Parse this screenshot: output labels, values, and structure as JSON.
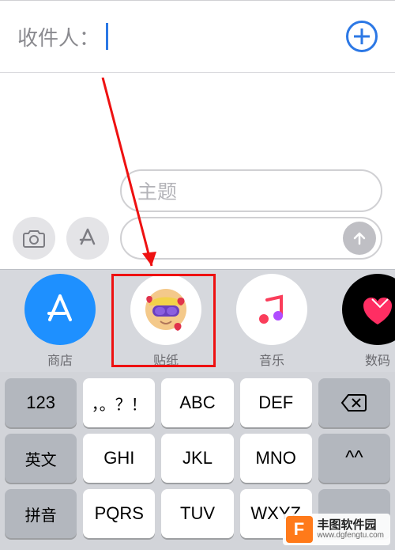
{
  "recipient": {
    "label": "收件人："
  },
  "compose": {
    "subject_placeholder": "主题"
  },
  "apps": {
    "store": {
      "label": "商店"
    },
    "sticker": {
      "label": "贴纸"
    },
    "music": {
      "label": "音乐"
    },
    "digital": {
      "label": "数码"
    }
  },
  "keyboard": {
    "row1": {
      "k0": "123",
      "k1": "，。？！",
      "k2": "ABC",
      "k3": "DEF"
    },
    "row2": {
      "k0": "英文",
      "k1": "GHI",
      "k2": "JKL",
      "k3": "MNO",
      "k4": "^^"
    },
    "row3": {
      "k0": "拼音",
      "k1": "PQRS",
      "k2": "TUV",
      "k3": "WXYZ"
    }
  },
  "watermark": {
    "badge": "F",
    "title": "丰图软件园",
    "url": "www.dgfengtu.com"
  },
  "colors": {
    "accent": "#2c78e5",
    "annotation": "#e11"
  }
}
